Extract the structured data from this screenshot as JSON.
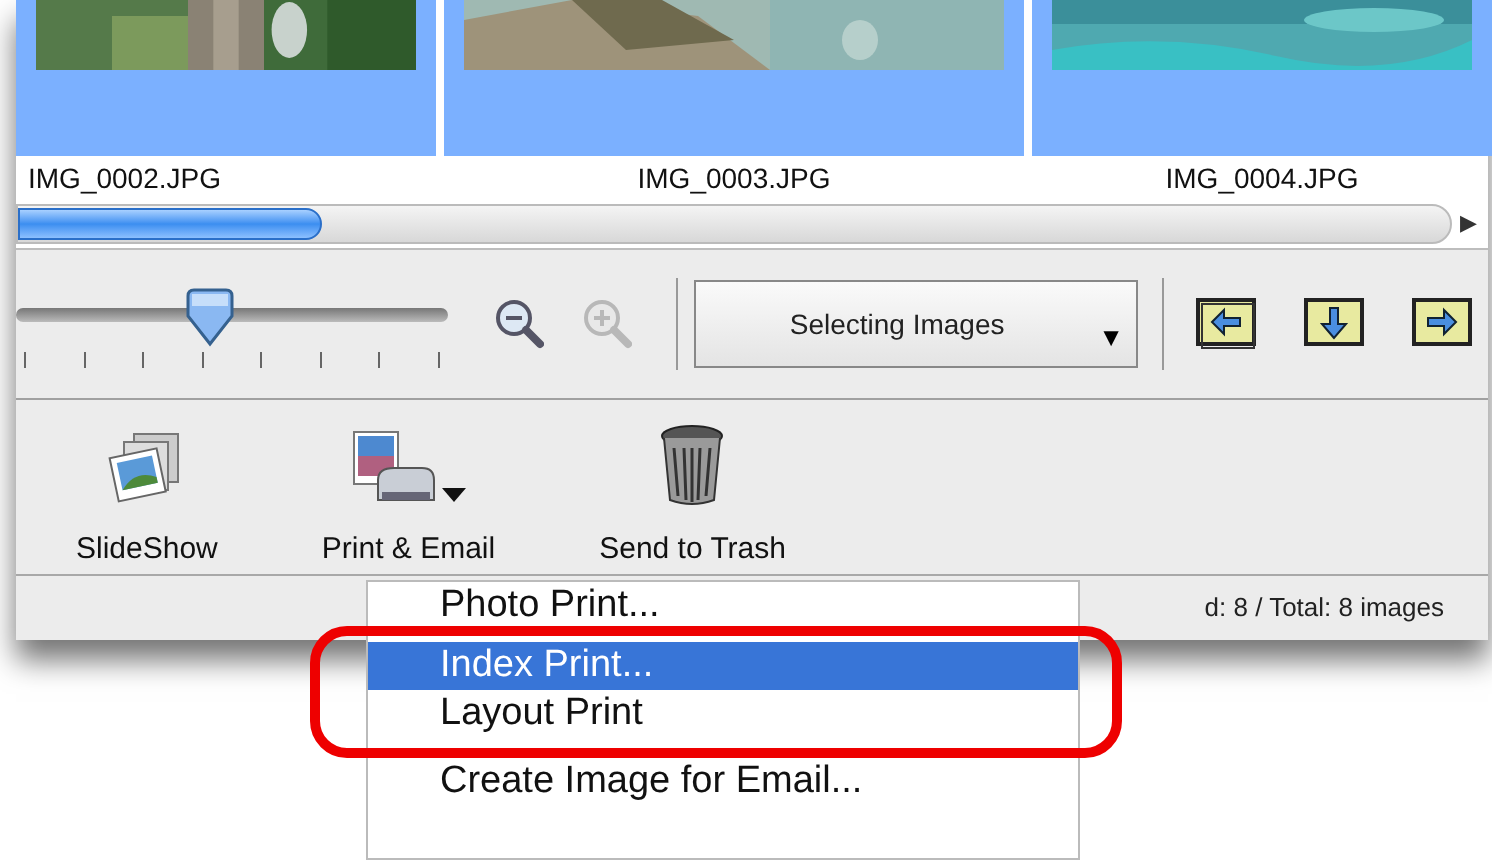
{
  "thumbnails": [
    {
      "filename": "IMG_0002.JPG",
      "selected": true,
      "kind": "picture"
    },
    {
      "filename": "IMG_0003.JPG",
      "selected": true,
      "kind": "picture"
    },
    {
      "filename": "IMG_0004.JPG",
      "selected": true,
      "kind": "picture"
    }
  ],
  "size_slider": {
    "level": 0.44
  },
  "zoom_buttons": [
    {
      "kind": "out",
      "disabled": false
    },
    {
      "kind": "in",
      "disabled": true
    }
  ],
  "mode_dropdown": {
    "value": "Selecting Images",
    "arrow": "▼"
  },
  "scroll_arrow": "▶",
  "toolbar": [
    {
      "label": "SlideShow",
      "kind": "slideshow",
      "has_menu": false
    },
    {
      "label": "Print & Email",
      "kind": "print",
      "has_menu": true
    },
    {
      "label": "Send to Trash",
      "kind": "trash",
      "has_menu": false
    }
  ],
  "status_bar": {
    "text": "d: 8 / Total: 8 images"
  },
  "menu": {
    "items": [
      {
        "label": "Photo Print...",
        "selected": false
      },
      {
        "label": "Index Print...",
        "selected": true
      },
      {
        "label": "Layout Print",
        "selected": false
      },
      {
        "label": "Create Image for Email...",
        "selected": false
      }
    ]
  }
}
